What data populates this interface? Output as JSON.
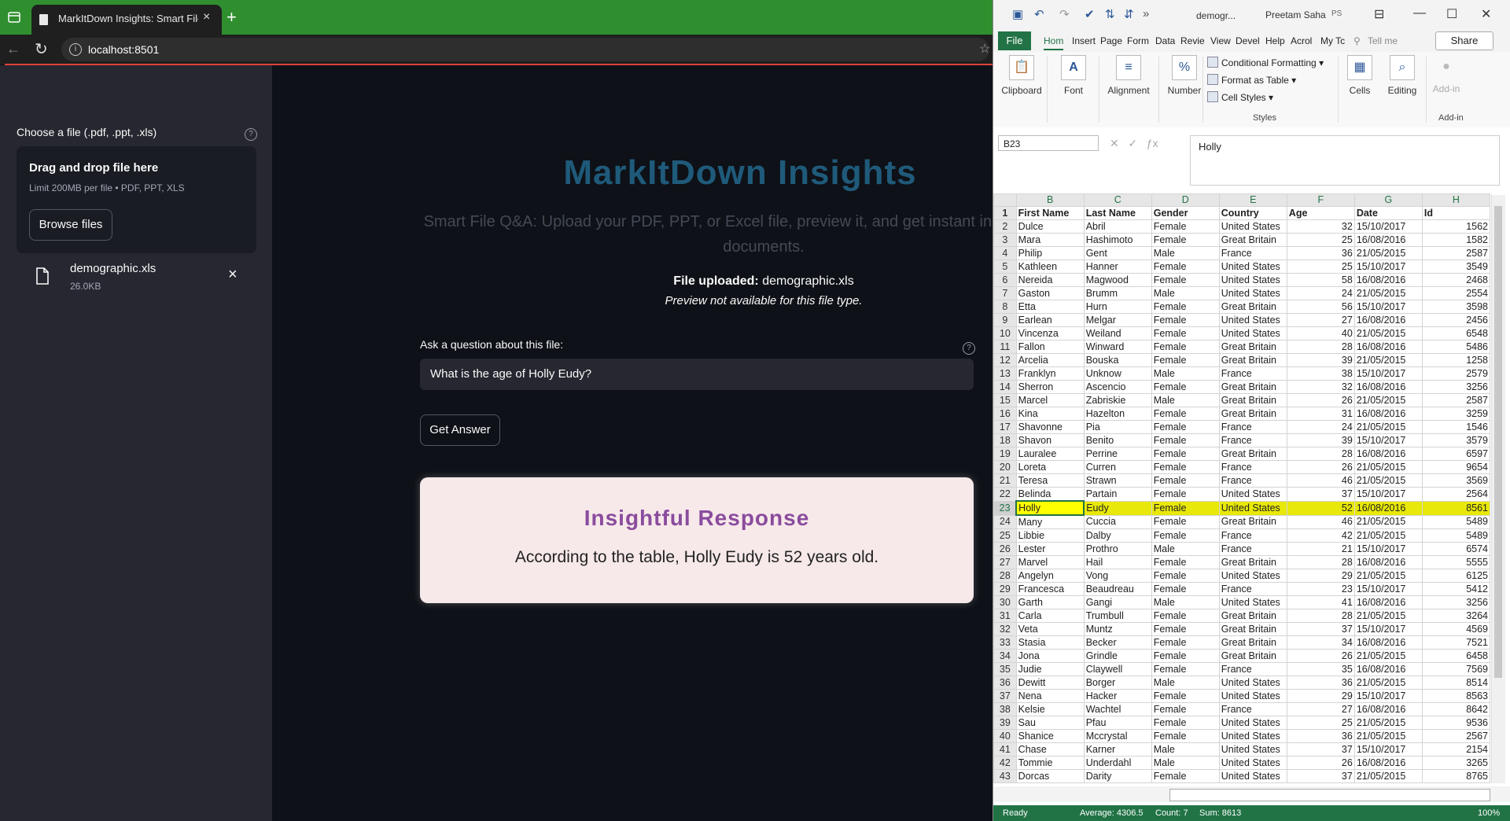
{
  "browser": {
    "tab_title": "MarkItDown Insights: Smart File Q&A",
    "tab_close": "×",
    "new_tab": "+",
    "url": "localhost:8501"
  },
  "sidebar": {
    "uploader_label": "Choose a file (.pdf, .ppt, .xls)",
    "help": "?",
    "drop_title": "Drag and drop file here",
    "drop_limit": "Limit 200MB per file • PDF, PPT, XLS",
    "browse_label": "Browse files",
    "file_name": "demographic.xls",
    "file_size": "26.0KB",
    "remove": "×"
  },
  "main": {
    "title": "MarkItDown Insights",
    "subtitle": "Smart File Q&A: Upload your PDF, PPT, or Excel file, preview it, and get instant insights from your documents.",
    "uploaded_label": "File uploaded:",
    "uploaded_file": "demographic.xls",
    "preview_note": "Preview not available for this file type.",
    "ask_label": "Ask a question about this file:",
    "question": "What is the age of Holly Eudy?",
    "get_answer": "Get Answer",
    "response_title": "Insightful Response",
    "response_text": "According to the table, Holly Eudy is 52 years old."
  },
  "excel": {
    "doc_name": "demogr...",
    "user": "Preetam Saha",
    "initials": "PS",
    "tabs": [
      "File",
      "Hom",
      "Insert",
      "Page",
      "Form",
      "Data",
      "Revie",
      "View",
      "Devel",
      "Help",
      "Acrol",
      "My Tc",
      "Tell me"
    ],
    "share": "Share",
    "ribbon": {
      "clipboard": "Clipboard",
      "font": "Font",
      "alignment": "Alignment",
      "number": "Number",
      "cond_format": "Conditional Formatting",
      "format_table": "Format as Table",
      "cell_styles": "Cell Styles",
      "styles": "Styles",
      "cells": "Cells",
      "editing": "Editing",
      "addins": "Add-in",
      "addins_group": "Add-in"
    },
    "name_box": "B23",
    "formula": "Holly",
    "columns": [
      "B",
      "C",
      "D",
      "E",
      "F",
      "G",
      "H"
    ],
    "header_row": [
      "First Name",
      "Last Name",
      "Gender",
      "Country",
      "Age",
      "Date",
      "Id"
    ],
    "rows": [
      [
        "Dulce",
        "Abril",
        "Female",
        "United States",
        "32",
        "15/10/2017",
        "1562"
      ],
      [
        "Mara",
        "Hashimoto",
        "Female",
        "Great Britain",
        "25",
        "16/08/2016",
        "1582"
      ],
      [
        "Philip",
        "Gent",
        "Male",
        "France",
        "36",
        "21/05/2015",
        "2587"
      ],
      [
        "Kathleen",
        "Hanner",
        "Female",
        "United States",
        "25",
        "15/10/2017",
        "3549"
      ],
      [
        "Nereida",
        "Magwood",
        "Female",
        "United States",
        "58",
        "16/08/2016",
        "2468"
      ],
      [
        "Gaston",
        "Brumm",
        "Male",
        "United States",
        "24",
        "21/05/2015",
        "2554"
      ],
      [
        "Etta",
        "Hurn",
        "Female",
        "Great Britain",
        "56",
        "15/10/2017",
        "3598"
      ],
      [
        "Earlean",
        "Melgar",
        "Female",
        "United States",
        "27",
        "16/08/2016",
        "2456"
      ],
      [
        "Vincenza",
        "Weiland",
        "Female",
        "United States",
        "40",
        "21/05/2015",
        "6548"
      ],
      [
        "Fallon",
        "Winward",
        "Female",
        "Great Britain",
        "28",
        "16/08/2016",
        "5486"
      ],
      [
        "Arcelia",
        "Bouska",
        "Female",
        "Great Britain",
        "39",
        "21/05/2015",
        "1258"
      ],
      [
        "Franklyn",
        "Unknow",
        "Male",
        "France",
        "38",
        "15/10/2017",
        "2579"
      ],
      [
        "Sherron",
        "Ascencio",
        "Female",
        "Great Britain",
        "32",
        "16/08/2016",
        "3256"
      ],
      [
        "Marcel",
        "Zabriskie",
        "Male",
        "Great Britain",
        "26",
        "21/05/2015",
        "2587"
      ],
      [
        "Kina",
        "Hazelton",
        "Female",
        "Great Britain",
        "31",
        "16/08/2016",
        "3259"
      ],
      [
        "Shavonne",
        "Pia",
        "Female",
        "France",
        "24",
        "21/05/2015",
        "1546"
      ],
      [
        "Shavon",
        "Benito",
        "Female",
        "France",
        "39",
        "15/10/2017",
        "3579"
      ],
      [
        "Lauralee",
        "Perrine",
        "Female",
        "Great Britain",
        "28",
        "16/08/2016",
        "6597"
      ],
      [
        "Loreta",
        "Curren",
        "Female",
        "France",
        "26",
        "21/05/2015",
        "9654"
      ],
      [
        "Teresa",
        "Strawn",
        "Female",
        "France",
        "46",
        "21/05/2015",
        "3569"
      ],
      [
        "Belinda",
        "Partain",
        "Female",
        "United States",
        "37",
        "15/10/2017",
        "2564"
      ],
      [
        "Holly",
        "Eudy",
        "Female",
        "United States",
        "52",
        "16/08/2016",
        "8561"
      ],
      [
        "Many",
        "Cuccia",
        "Female",
        "Great Britain",
        "46",
        "21/05/2015",
        "5489"
      ],
      [
        "Libbie",
        "Dalby",
        "Female",
        "France",
        "42",
        "21/05/2015",
        "5489"
      ],
      [
        "Lester",
        "Prothro",
        "Male",
        "France",
        "21",
        "15/10/2017",
        "6574"
      ],
      [
        "Marvel",
        "Hail",
        "Female",
        "Great Britain",
        "28",
        "16/08/2016",
        "5555"
      ],
      [
        "Angelyn",
        "Vong",
        "Female",
        "United States",
        "29",
        "21/05/2015",
        "6125"
      ],
      [
        "Francesca",
        "Beaudreau",
        "Female",
        "France",
        "23",
        "15/10/2017",
        "5412"
      ],
      [
        "Garth",
        "Gangi",
        "Male",
        "United States",
        "41",
        "16/08/2016",
        "3256"
      ],
      [
        "Carla",
        "Trumbull",
        "Female",
        "Great Britain",
        "28",
        "21/05/2015",
        "3264"
      ],
      [
        "Veta",
        "Muntz",
        "Female",
        "Great Britain",
        "37",
        "15/10/2017",
        "4569"
      ],
      [
        "Stasia",
        "Becker",
        "Female",
        "Great Britain",
        "34",
        "16/08/2016",
        "7521"
      ],
      [
        "Jona",
        "Grindle",
        "Female",
        "Great Britain",
        "26",
        "21/05/2015",
        "6458"
      ],
      [
        "Judie",
        "Claywell",
        "Female",
        "France",
        "35",
        "16/08/2016",
        "7569"
      ],
      [
        "Dewitt",
        "Borger",
        "Male",
        "United States",
        "36",
        "21/05/2015",
        "8514"
      ],
      [
        "Nena",
        "Hacker",
        "Female",
        "United States",
        "29",
        "15/10/2017",
        "8563"
      ],
      [
        "Kelsie",
        "Wachtel",
        "Female",
        "France",
        "27",
        "16/08/2016",
        "8642"
      ],
      [
        "Sau",
        "Pfau",
        "Female",
        "United States",
        "25",
        "21/05/2015",
        "9536"
      ],
      [
        "Shanice",
        "Mccrystal",
        "Female",
        "United States",
        "36",
        "21/05/2015",
        "2567"
      ],
      [
        "Chase",
        "Karner",
        "Male",
        "United States",
        "37",
        "15/10/2017",
        "2154"
      ],
      [
        "Tommie",
        "Underdahl",
        "Male",
        "United States",
        "26",
        "16/08/2016",
        "3265"
      ],
      [
        "Dorcas",
        "Darity",
        "Female",
        "United States",
        "37",
        "21/05/2015",
        "8765"
      ]
    ],
    "selected_row": 23,
    "status": {
      "ready": "Ready",
      "average": "Average: 4306.5",
      "count": "Count: 7",
      "sum": "Sum: 8613",
      "zoom": "100%"
    }
  }
}
